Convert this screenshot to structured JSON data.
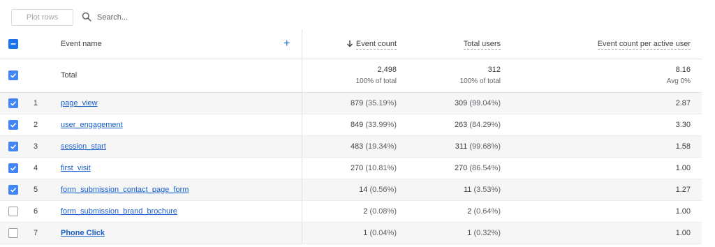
{
  "toolbar": {
    "plot_rows_label": "Plot rows",
    "search_placeholder": "Search..."
  },
  "table": {
    "headers": {
      "event_name": "Event name",
      "event_count": "Event count",
      "total_users": "Total users",
      "event_count_per_active_user": "Event count per active user"
    },
    "sort": {
      "column": "event_count",
      "direction": "descending"
    },
    "total": {
      "label": "Total",
      "event_count": "2,498",
      "event_count_sub": "100% of total",
      "total_users": "312",
      "total_users_sub": "100% of total",
      "per_user": "8.16",
      "per_user_sub": "Avg 0%"
    },
    "rows": [
      {
        "index": "1",
        "checked": true,
        "name": "page_view",
        "event_count": "879",
        "event_count_pct": "(35.19%)",
        "total_users": "309",
        "total_users_pct": "(99.04%)",
        "per_user": "2.87"
      },
      {
        "index": "2",
        "checked": true,
        "name": "user_engagement",
        "event_count": "849",
        "event_count_pct": "(33.99%)",
        "total_users": "263",
        "total_users_pct": "(84.29%)",
        "per_user": "3.30"
      },
      {
        "index": "3",
        "checked": true,
        "name": "session_start",
        "event_count": "483",
        "event_count_pct": "(19.34%)",
        "total_users": "311",
        "total_users_pct": "(99.68%)",
        "per_user": "1.58"
      },
      {
        "index": "4",
        "checked": true,
        "name": "first_visit",
        "event_count": "270",
        "event_count_pct": "(10.81%)",
        "total_users": "270",
        "total_users_pct": "(86.54%)",
        "per_user": "1.00"
      },
      {
        "index": "5",
        "checked": true,
        "name": "form_submission_contact_page_form",
        "event_count": "14",
        "event_count_pct": "(0.56%)",
        "total_users": "11",
        "total_users_pct": "(3.53%)",
        "per_user": "1.27"
      },
      {
        "index": "6",
        "checked": false,
        "name": "form_submission_brand_brochure",
        "event_count": "2",
        "event_count_pct": "(0.08%)",
        "total_users": "2",
        "total_users_pct": "(0.64%)",
        "per_user": "1.00"
      },
      {
        "index": "7",
        "checked": false,
        "name": "Phone Click",
        "event_count": "1",
        "event_count_pct": "(0.04%)",
        "total_users": "1",
        "total_users_pct": "(0.32%)",
        "per_user": "1.00",
        "bold": true
      }
    ]
  },
  "colors": {
    "checkbox_checked": "#4285f4",
    "link": "#1a5fc7",
    "row_stripe": "#f6f6f6"
  },
  "icons": {
    "search": "search-icon",
    "add_dimension": "plus-icon",
    "sort": "arrow-down-icon",
    "checkbox_checked": "checkmark-icon",
    "select_all": "indeterminate-icon"
  }
}
